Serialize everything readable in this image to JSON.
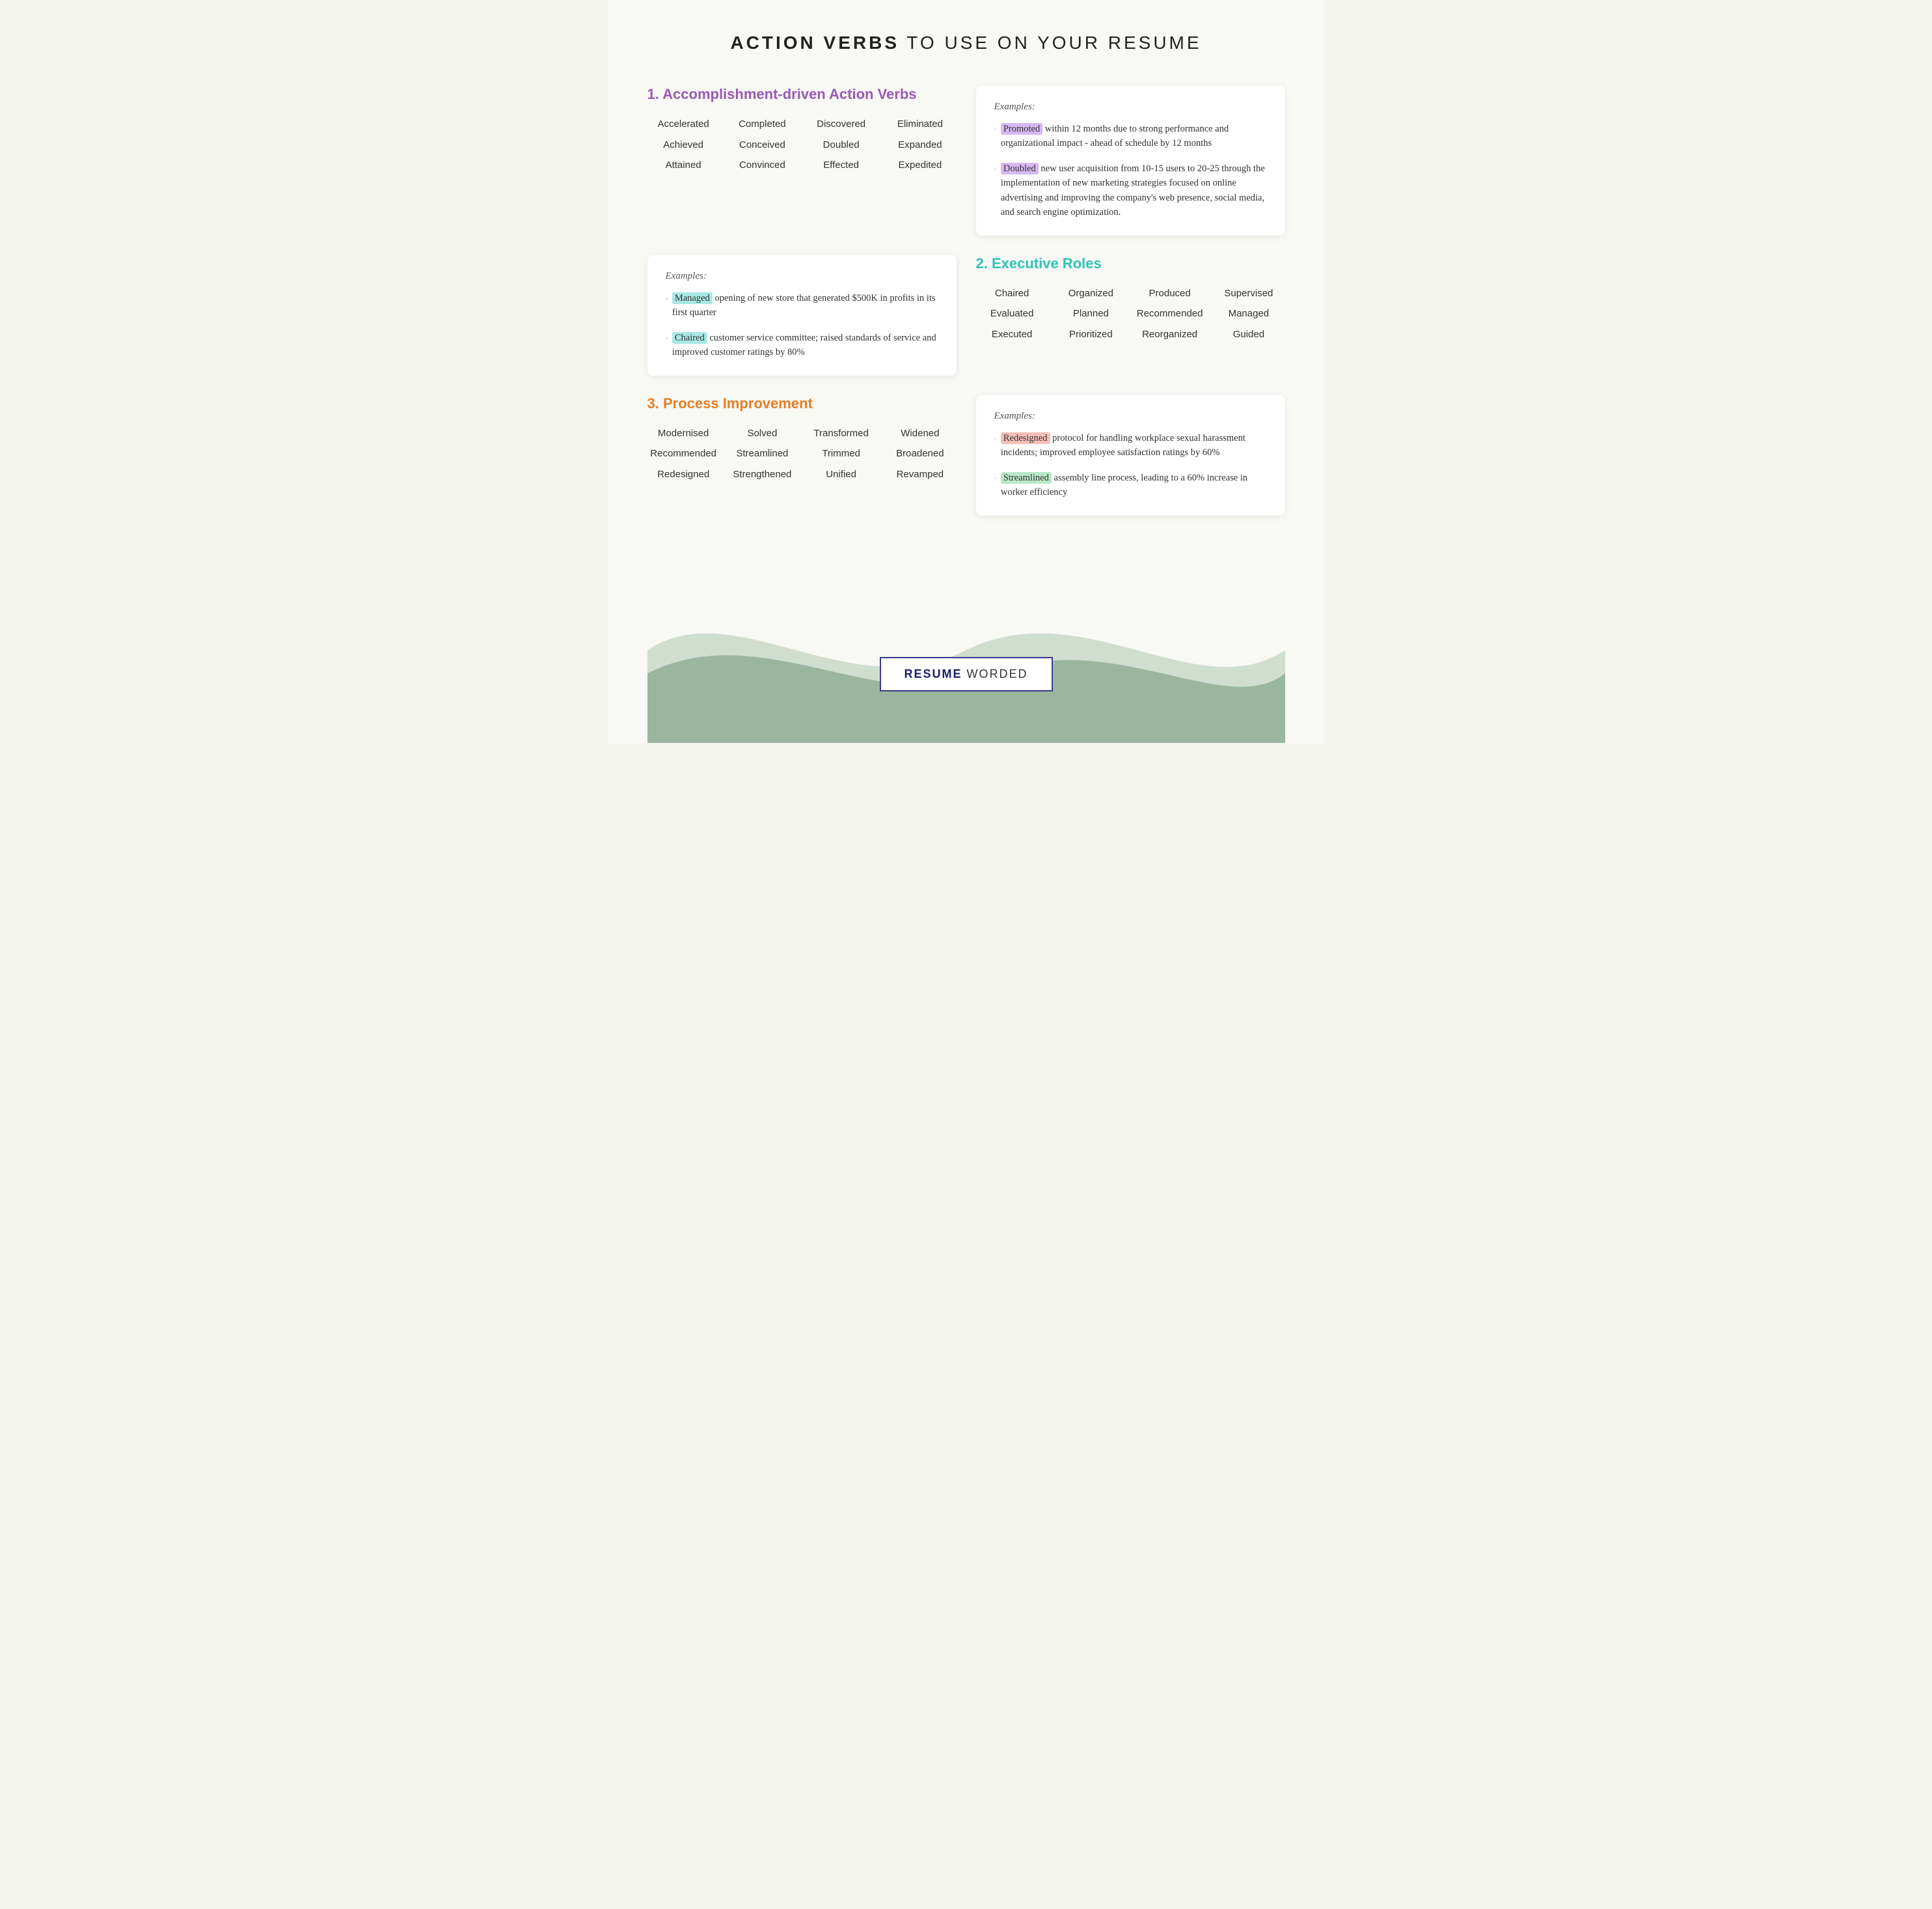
{
  "page": {
    "title_bold": "ACTION VERBS",
    "title_rest": " TO USE ON YOUR RESUME"
  },
  "section1": {
    "title": "1. Accomplishment-driven Action Verbs",
    "words": [
      [
        "Accelerated",
        "Completed",
        "Discovered",
        "Eliminated"
      ],
      [
        "Achieved",
        "Conceived",
        "Doubled",
        "Expanded"
      ],
      [
        "Attained",
        "Convinced",
        "Effected",
        "Expedited"
      ]
    ],
    "example_label": "Examples:",
    "examples": [
      {
        "highlight": "Promoted",
        "highlight_class": "highlight-purple",
        "rest": " within 12 months due to strong performance and organizational impact - ahead of schedule by 12 months"
      },
      {
        "highlight": "Doubled",
        "highlight_class": "highlight-purple",
        "rest": " new user acquisition from 10-15 users to 20-25 through the implementation of new marketing strategies focused on online advertising and improving the company's web presence, social media, and search engine optimization."
      }
    ]
  },
  "section1_left_example": {
    "example_label": "Examples:",
    "examples": [
      {
        "highlight": "Managed",
        "highlight_class": "highlight-teal",
        "rest": " opening of new store that generated $500K in profits in its first quarter"
      },
      {
        "highlight": "Chaired",
        "highlight_class": "highlight-teal",
        "rest": " customer service committee; raised standards of service and improved customer ratings by 80%"
      }
    ]
  },
  "section2": {
    "title": "2. Executive Roles",
    "words": [
      [
        "Chaired",
        "Organized",
        "Produced",
        "Supervised"
      ],
      [
        "Evaluated",
        "Planned",
        "Recommended",
        "Managed"
      ],
      [
        "Executed",
        "Prioritized",
        "Reorganized",
        "Guided"
      ]
    ]
  },
  "section3": {
    "title": "3. Process Improvement",
    "words": [
      [
        "Modernised",
        "Solved",
        "Transformed",
        "Widened"
      ],
      [
        "Recommended",
        "Streamlined",
        "Trimmed",
        "Broadened"
      ],
      [
        "Redesigned",
        "Strengthened",
        "Unified",
        "Revamped"
      ]
    ],
    "example_label": "Examples:",
    "examples": [
      {
        "highlight": "Redesigned",
        "highlight_class": "highlight-pink",
        "rest": " protocol for handling workplace sexual harassment incidents; improved employee satisfaction ratings by 60%"
      },
      {
        "highlight": "Streamlined",
        "highlight_class": "highlight-green",
        "rest": " assembly line process, leading to a 60% increase in worker efficiency"
      }
    ]
  },
  "logo": {
    "bold": "RESUME",
    "rest": " WORDED"
  }
}
